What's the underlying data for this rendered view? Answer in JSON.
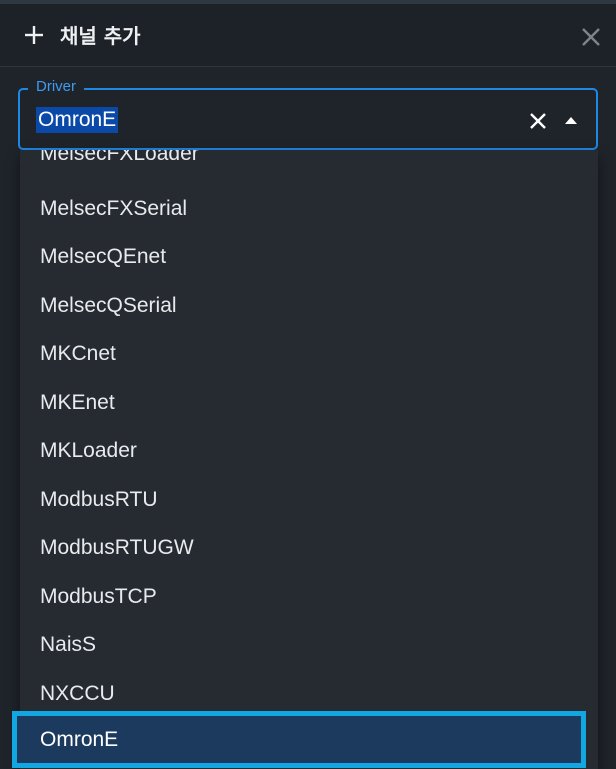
{
  "header": {
    "title": "채널 추가",
    "plus_icon": "plus-icon",
    "close_icon": "close-icon"
  },
  "driver": {
    "label": "Driver",
    "value": "OmronE",
    "clear_icon": "clear-icon",
    "toggle_icon": "caret-up-icon"
  },
  "dropdown": {
    "options": [
      "MelsecFXLoader",
      "MelsecFXSerial",
      "MelsecQEnet",
      "MelsecQSerial",
      "MKCnet",
      "MKEnet",
      "MKLoader",
      "ModbusRTU",
      "ModbusRTUGW",
      "ModbusTCP",
      "NaisS",
      "NXCCU"
    ],
    "selected": "OmronE"
  },
  "colors": {
    "background": "#1f242b",
    "dropdown": "#262b32",
    "accent": "#1e88e5",
    "highlight_border": "#12a7e3",
    "highlight_fill": "#1b3a5e"
  }
}
